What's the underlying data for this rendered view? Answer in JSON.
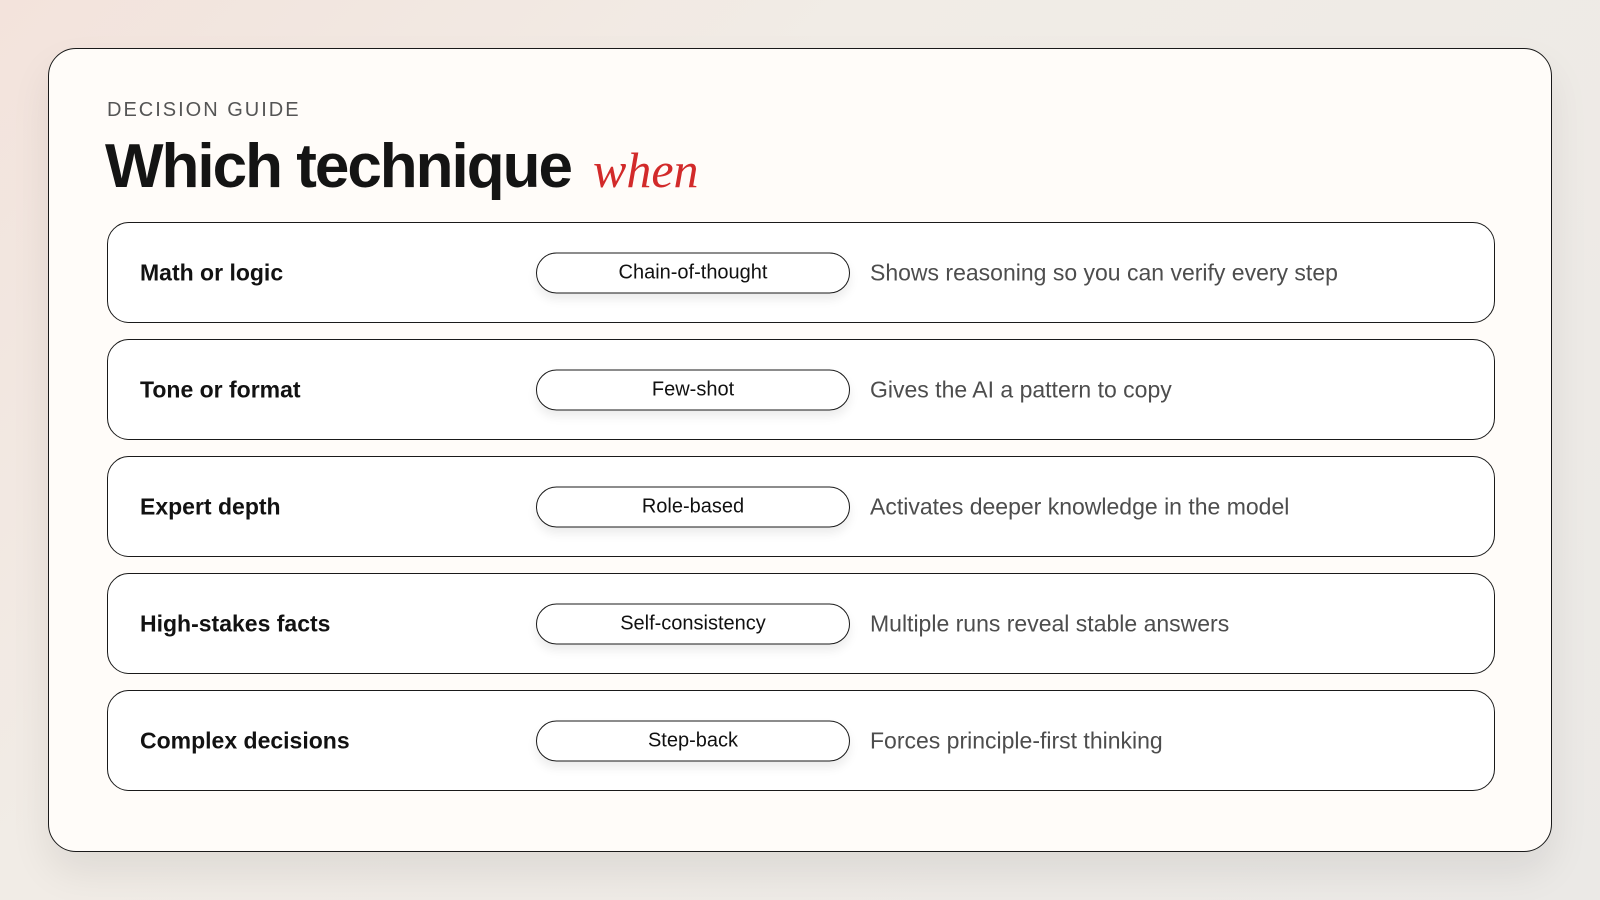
{
  "header": {
    "eyebrow": "DECISION GUIDE",
    "title": "Which technique",
    "title_accent": "when"
  },
  "colors": {
    "accent": "#d22a2a",
    "text": "#141414",
    "muted": "#4d4d4d",
    "card": "#fffcf9"
  },
  "rows": [
    {
      "label": "Math or logic",
      "technique": "Chain-of-thought",
      "description": "Shows reasoning so you can verify every step"
    },
    {
      "label": "Tone or format",
      "technique": "Few-shot",
      "description": "Gives the AI a pattern to copy"
    },
    {
      "label": "Expert depth",
      "technique": "Role-based",
      "description": "Activates deeper knowledge in the model"
    },
    {
      "label": "High-stakes facts",
      "technique": "Self-consistency",
      "description": "Multiple runs reveal stable answers"
    },
    {
      "label": "Complex decisions",
      "technique": "Step-back",
      "description": "Forces principle-first thinking"
    }
  ]
}
